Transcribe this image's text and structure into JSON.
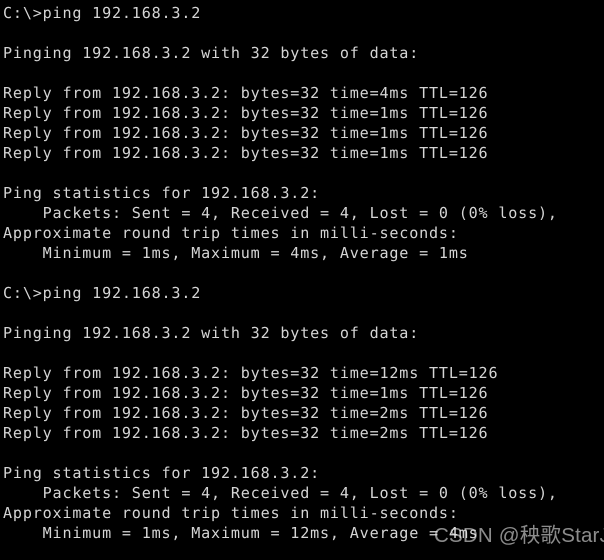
{
  "terminal": {
    "background_color": "#000000",
    "text_color": "#d5d5d5",
    "prompt": "C:\\>",
    "command": "ping 192.168.3.2",
    "target_host": "192.168.3.2",
    "console_output": "C:\\>ping 192.168.3.2\n\nPinging 192.168.3.2 with 32 bytes of data:\n\nReply from 192.168.3.2: bytes=32 time=4ms TTL=126\nReply from 192.168.3.2: bytes=32 time=1ms TTL=126\nReply from 192.168.3.2: bytes=32 time=1ms TTL=126\nReply from 192.168.3.2: bytes=32 time=1ms TTL=126\n\nPing statistics for 192.168.3.2:\n    Packets: Sent = 4, Received = 4, Lost = 0 (0% loss),\nApproximate round trip times in milli-seconds:\n    Minimum = 1ms, Maximum = 4ms, Average = 1ms\n\nC:\\>ping 192.168.3.2\n\nPinging 192.168.3.2 with 32 bytes of data:\n\nReply from 192.168.3.2: bytes=32 time=12ms TTL=126\nReply from 192.168.3.2: bytes=32 time=1ms TTL=126\nReply from 192.168.3.2: bytes=32 time=2ms TTL=126\nReply from 192.168.3.2: bytes=32 time=2ms TTL=126\n\nPing statistics for 192.168.3.2:\n    Packets: Sent = 4, Received = 4, Lost = 0 (0% loss),\nApproximate round trip times in milli-seconds:\n    Minimum = 1ms, Maximum = 12ms, Average = 4ms",
    "sessions": [
      {
        "command_line": "C:\\>ping 192.168.3.2",
        "header": "Pinging 192.168.3.2 with 32 bytes of data:",
        "replies": [
          "Reply from 192.168.3.2: bytes=32 time=4ms TTL=126",
          "Reply from 192.168.3.2: bytes=32 time=1ms TTL=126",
          "Reply from 192.168.3.2: bytes=32 time=1ms TTL=126",
          "Reply from 192.168.3.2: bytes=32 time=1ms TTL=126"
        ],
        "reply_times_ms": [
          4,
          1,
          1,
          1
        ],
        "bytes": 32,
        "ttl": 126,
        "statistics_header": "Ping statistics for 192.168.3.2:",
        "packets_line": "    Packets: Sent = 4, Received = 4, Lost = 0 (0% loss),",
        "packets": {
          "sent": 4,
          "received": 4,
          "lost": 0,
          "loss_percent": "0%"
        },
        "rtt_header": "Approximate round trip times in milli-seconds:",
        "rtt_line": "    Minimum = 1ms, Maximum = 4ms, Average = 1ms",
        "rtt": {
          "minimum": "1ms",
          "maximum": "4ms",
          "average": "1ms"
        }
      },
      {
        "command_line": "C:\\>ping 192.168.3.2",
        "header": "Pinging 192.168.3.2 with 32 bytes of data:",
        "replies": [
          "Reply from 192.168.3.2: bytes=32 time=12ms TTL=126",
          "Reply from 192.168.3.2: bytes=32 time=1ms TTL=126",
          "Reply from 192.168.3.2: bytes=32 time=2ms TTL=126",
          "Reply from 192.168.3.2: bytes=32 time=2ms TTL=126"
        ],
        "reply_times_ms": [
          12,
          1,
          2,
          2
        ],
        "bytes": 32,
        "ttl": 126,
        "statistics_header": "Ping statistics for 192.168.3.2:",
        "packets_line": "    Packets: Sent = 4, Received = 4, Lost = 0 (0% loss),",
        "packets": {
          "sent": 4,
          "received": 4,
          "lost": 0,
          "loss_percent": "0%"
        },
        "rtt_header": "Approximate round trip times in milli-seconds:",
        "rtt_line": "    Minimum = 1ms, Maximum = 12ms, Average = 4ms",
        "rtt": {
          "minimum": "1ms",
          "maximum": "12ms",
          "average": "4ms"
        }
      }
    ]
  },
  "watermark": {
    "text": "CSDN @秧歌StarJO",
    "site": "CSDN",
    "author": "@秧歌StarJO",
    "color": "#e8e8e8"
  }
}
